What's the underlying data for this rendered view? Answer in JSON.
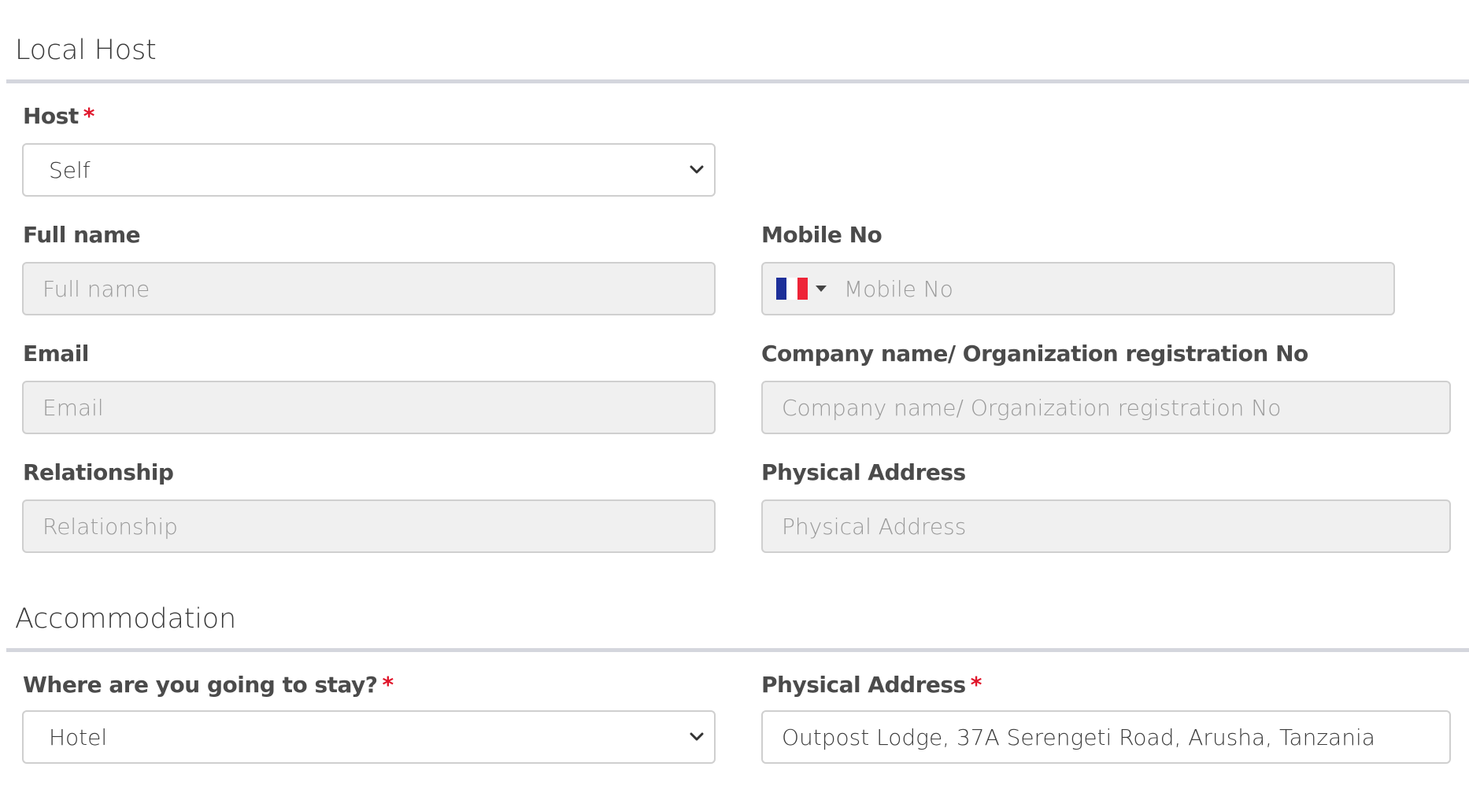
{
  "local_host": {
    "title": "Local Host",
    "host": {
      "label": "Host",
      "required_mark": "*",
      "value": "Self"
    },
    "full_name": {
      "label": "Full name",
      "placeholder": "Full name"
    },
    "mobile_no": {
      "label": "Mobile No",
      "placeholder": "Mobile No",
      "flag_colors": [
        "#1d2f99",
        "#ffffff",
        "#ee2438"
      ]
    },
    "email": {
      "label": "Email",
      "placeholder": "Email"
    },
    "company": {
      "label": "Company name/ Organization registration No",
      "placeholder": "Company name/ Organization registration No"
    },
    "relationship": {
      "label": "Relationship",
      "placeholder": "Relationship"
    },
    "physical_address": {
      "label": "Physical Address",
      "placeholder": "Physical Address"
    }
  },
  "accommodation": {
    "title": "Accommodation",
    "stay": {
      "label": "Where are you going to stay?",
      "required_mark": "*",
      "value": "Hotel"
    },
    "physical_address": {
      "label": "Physical Address",
      "required_mark": "*",
      "value": "Outpost Lodge, 37A Serengeti Road, Arusha, Tanzania"
    }
  },
  "colors": {
    "required": "#e0162b",
    "divider": "#d4d6dd",
    "disabled_bg": "#f0f0f0"
  }
}
